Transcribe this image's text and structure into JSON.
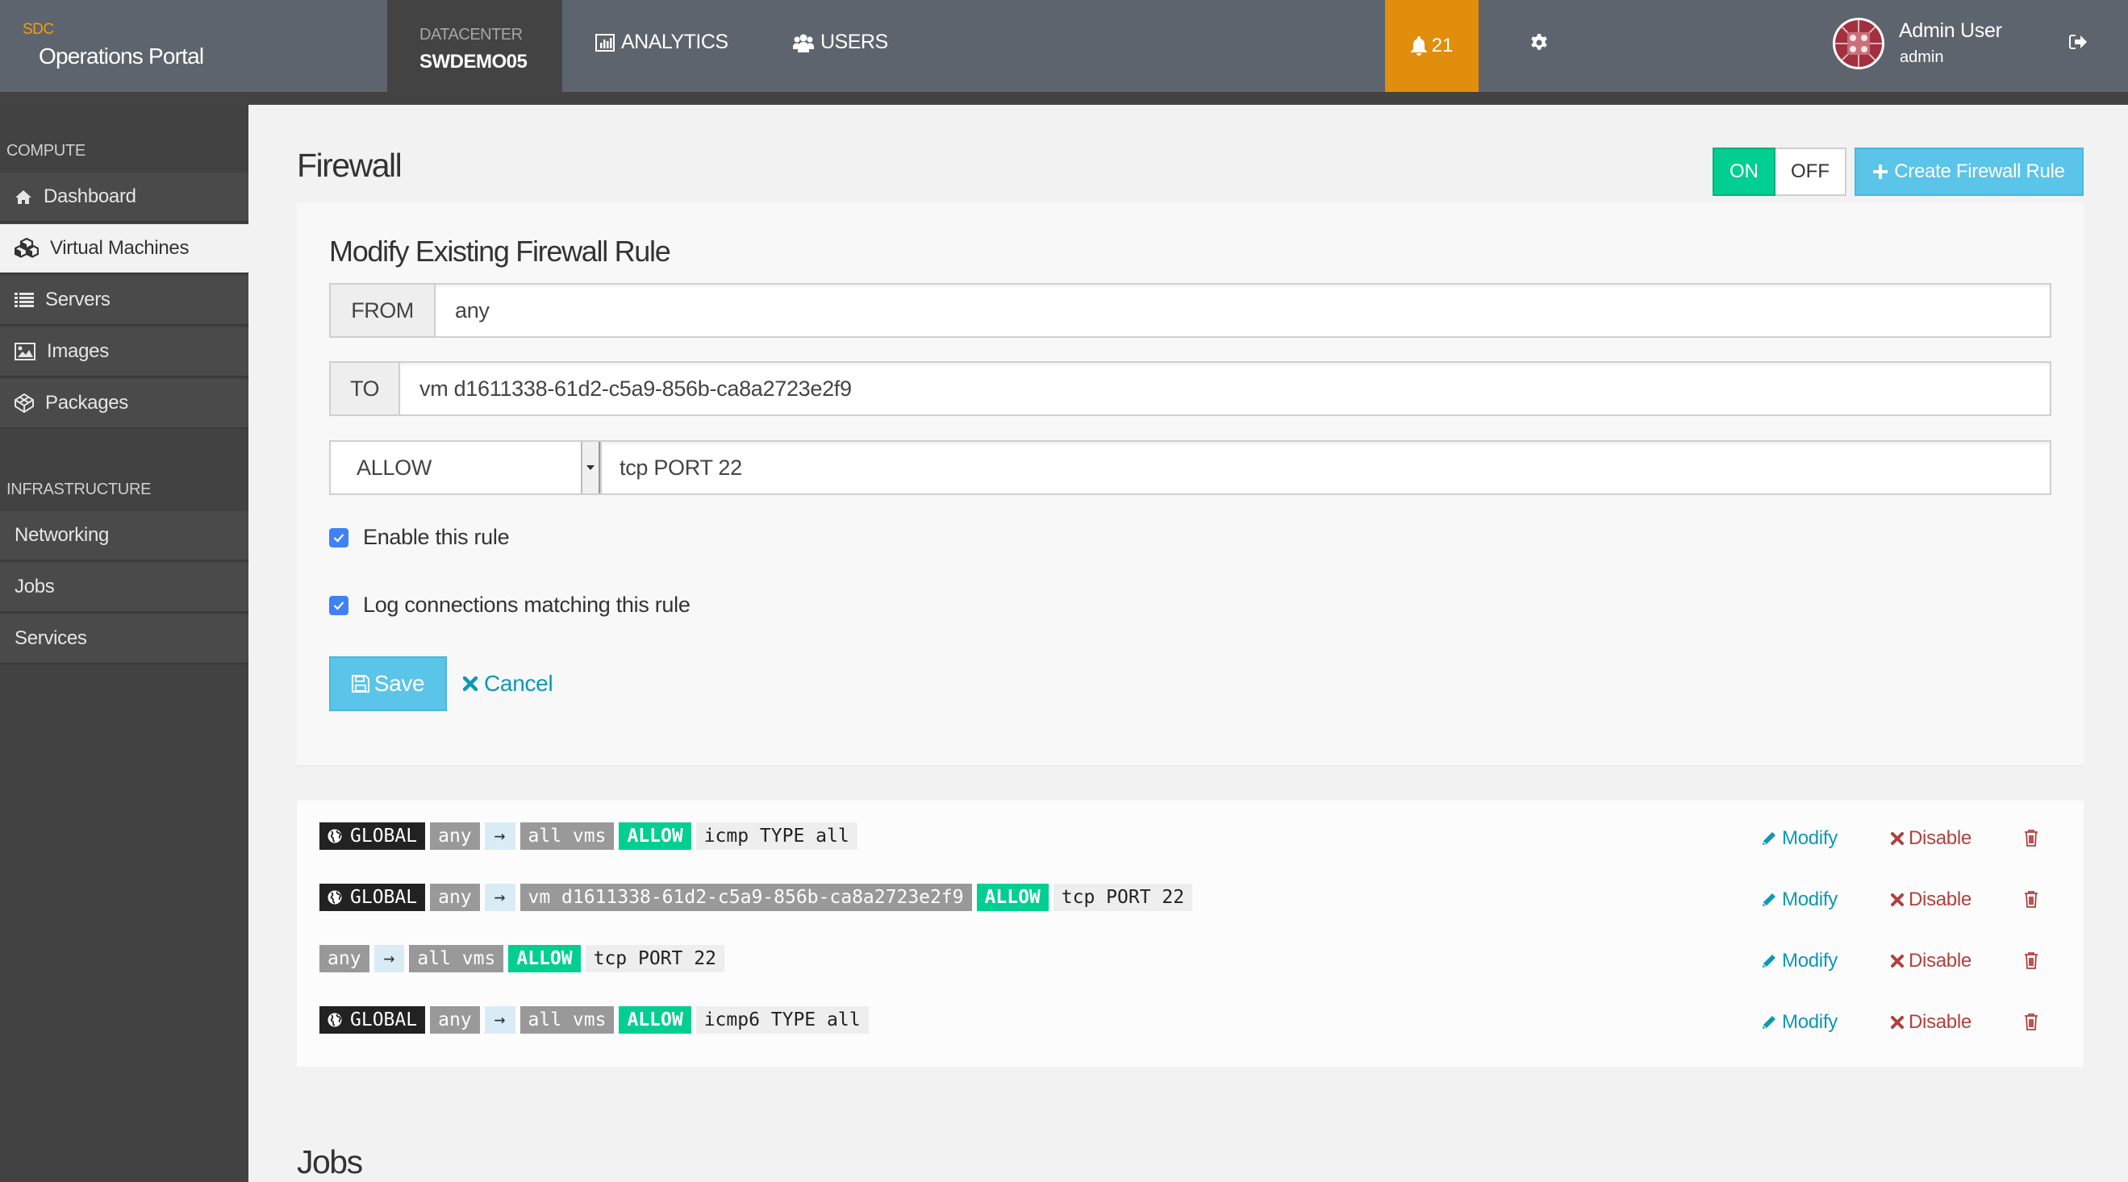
{
  "header": {
    "brand_small": "SDC",
    "brand_title": "Operations Portal",
    "datacenter_label": "DATACENTER",
    "datacenter_value": "SWDEMO05",
    "nav": [
      {
        "label": "ANALYTICS",
        "icon": "bar-chart-icon"
      },
      {
        "label": "USERS",
        "icon": "users-icon"
      }
    ],
    "notifications_count": "21",
    "user_name": "Admin User",
    "user_login": "admin"
  },
  "sidebar": {
    "sections": [
      {
        "label": "COMPUTE",
        "items": [
          {
            "label": "Dashboard",
            "icon": "home-icon",
            "active": false
          },
          {
            "label": "Virtual Machines",
            "icon": "cubes-icon",
            "active": true
          },
          {
            "label": "Servers",
            "icon": "list-icon",
            "active": false
          },
          {
            "label": "Images",
            "icon": "image-icon",
            "active": false
          },
          {
            "label": "Packages",
            "icon": "package-icon",
            "active": false
          }
        ]
      },
      {
        "label": "INFRASTRUCTURE",
        "items": [
          {
            "label": "Networking",
            "active": false
          },
          {
            "label": "Jobs",
            "active": false
          },
          {
            "label": "Services",
            "active": false
          }
        ]
      }
    ]
  },
  "firewall": {
    "title": "Firewall",
    "toggle_on": "ON",
    "toggle_off": "OFF",
    "toggle_state": "ON",
    "create_label": "Create Firewall Rule",
    "form": {
      "title": "Modify Existing Firewall Rule",
      "from_label": "FROM",
      "from_value": "any",
      "to_label": "TO",
      "to_value": "vm d1611338-61d2-c5a9-856b-ca8a2723e2f9",
      "action_value": "ALLOW",
      "protocol_value": "tcp PORT 22",
      "enable_label": "Enable this rule",
      "enable_checked": true,
      "log_label": "Log connections matching this rule",
      "log_checked": true,
      "save_label": "Save",
      "cancel_label": "Cancel"
    },
    "rules": [
      {
        "global": true,
        "global_label": "GLOBAL",
        "from": "any",
        "arrow": "→",
        "to": "all vms",
        "action": "ALLOW",
        "protocol": "icmp TYPE all",
        "modify": "Modify",
        "disable": "Disable"
      },
      {
        "global": true,
        "global_label": "GLOBAL",
        "from": "any",
        "arrow": "→",
        "to": "vm d1611338-61d2-c5a9-856b-ca8a2723e2f9",
        "action": "ALLOW",
        "protocol": "tcp PORT 22",
        "modify": "Modify",
        "disable": "Disable"
      },
      {
        "global": false,
        "from": "any",
        "arrow": "→",
        "to": "all vms",
        "action": "ALLOW",
        "protocol": "tcp PORT 22",
        "modify": "Modify",
        "disable": "Disable"
      },
      {
        "global": true,
        "global_label": "GLOBAL",
        "from": "any",
        "arrow": "→",
        "to": "all vms",
        "action": "ALLOW",
        "protocol": "icmp6 TYPE all",
        "modify": "Modify",
        "disable": "Disable"
      }
    ]
  },
  "jobs": {
    "title": "Jobs"
  },
  "colors": {
    "header_bg": "#5e646d",
    "accent_orange": "#e08e0b",
    "allow_green": "#00cf91",
    "info_blue": "#5bc4e9",
    "link_teal": "#0e98b3",
    "danger_red": "#b0413e"
  }
}
